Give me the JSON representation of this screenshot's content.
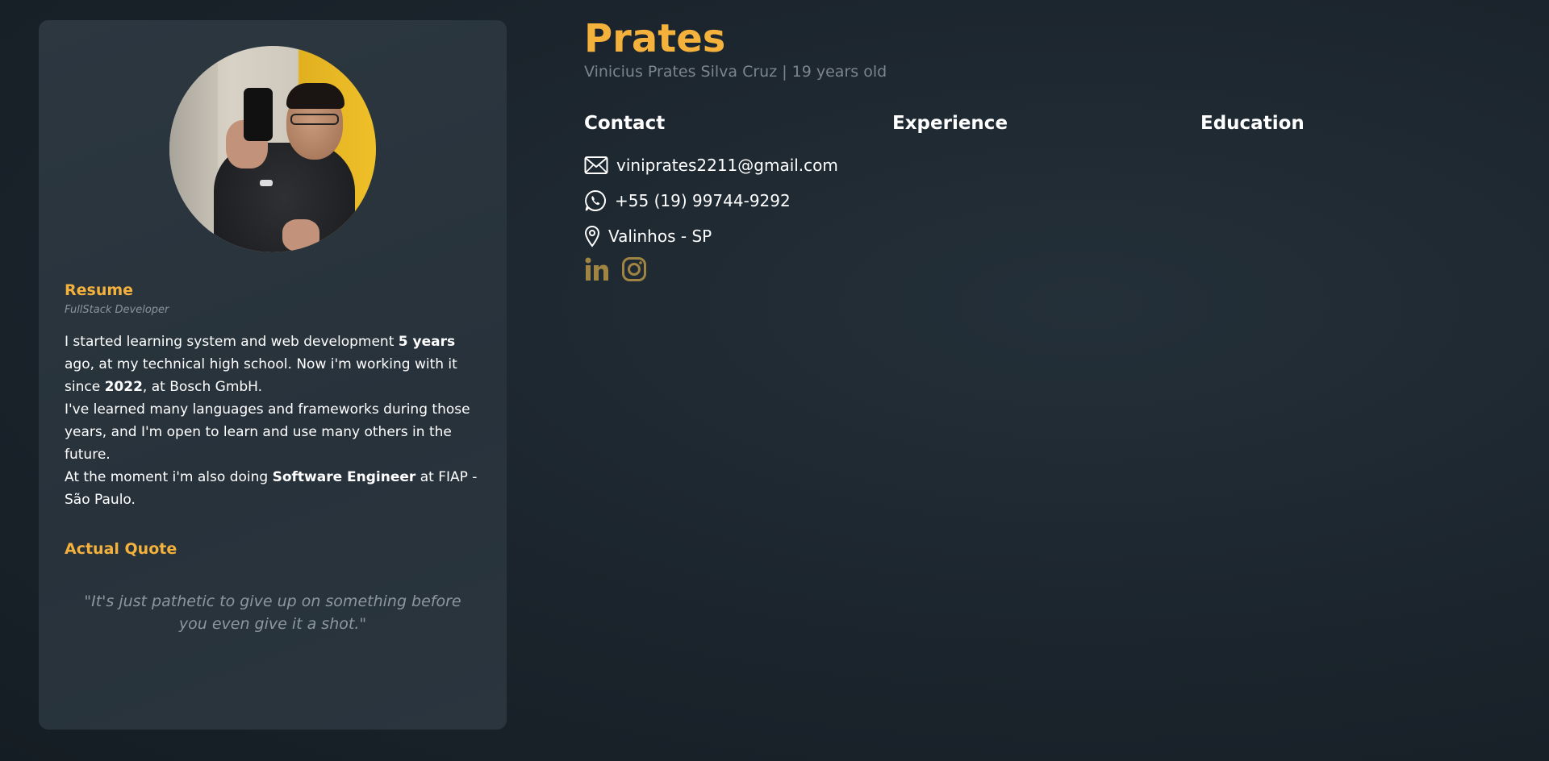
{
  "profile": {
    "name": "Prates",
    "subtitle": "Vinicius Prates Silva Cruz | 19 years old"
  },
  "resume": {
    "title": "Resume",
    "role": "FullStack Developer",
    "p1_a": "I started learning system and web development ",
    "p1_b": "5 years",
    "p1_c": " ago, at my technical high school. Now i'm working with it since ",
    "p1_d": "2022",
    "p1_e": ", at Bosch GmbH.",
    "p2": "I've learned many languages and frameworks during those years, and I'm open to learn and use many others in the future.",
    "p3_a": "At the moment i'm also doing ",
    "p3_b": "Software Engineer",
    "p3_c": " at FIAP - São Paulo."
  },
  "quote": {
    "title": "Actual Quote",
    "text": "\"It's just pathetic to give up on something before you even give it a shot.\""
  },
  "sections": {
    "contact": "Contact",
    "experience": "Experience",
    "education": "Education"
  },
  "contact": {
    "email": "viniprates2211@gmail.com",
    "phone": "+55 (19) 99744-9292",
    "location": "Valinhos - SP"
  },
  "icons": {
    "email": "envelope-icon",
    "phone": "whatsapp-icon",
    "location": "map-pin-icon",
    "linkedin": "linkedin-icon",
    "instagram": "instagram-icon"
  },
  "colors": {
    "accent": "#f4b13c",
    "social": "#a08444",
    "background": "#1b242c",
    "card": "#2a353e"
  }
}
